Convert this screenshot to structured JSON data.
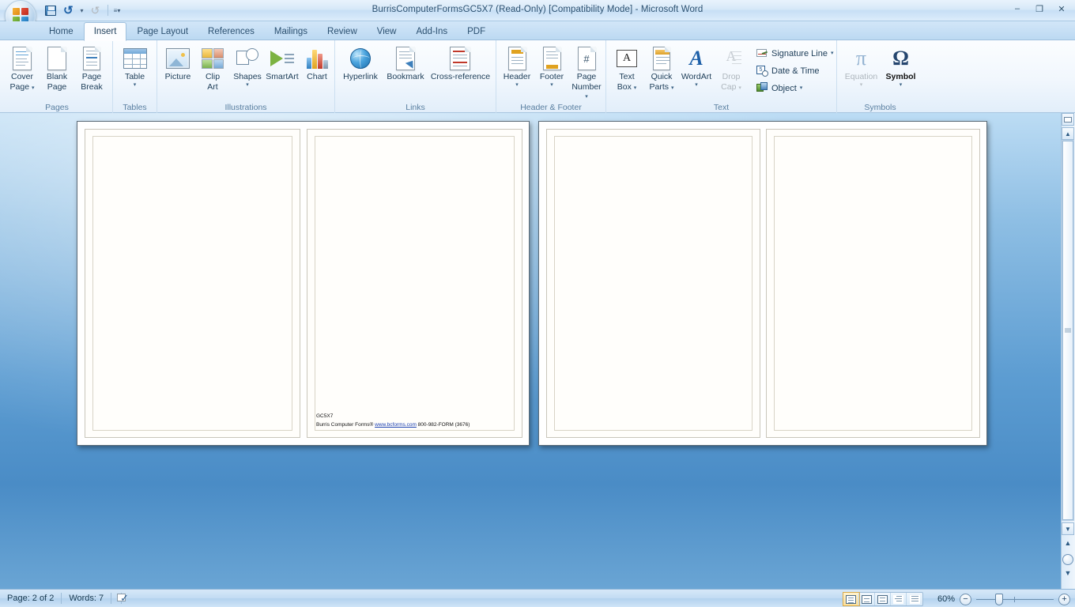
{
  "window": {
    "title": "BurrisComputerFormsGC5X7 (Read-Only) [Compatibility Mode] - Microsoft Word",
    "minimize": "–",
    "restore": "❐",
    "close": "✕",
    "help": "?"
  },
  "office_button": {
    "name": "Office Button"
  },
  "quick_access": {
    "save": "Save",
    "undo": "Undo",
    "redo": "Redo",
    "customize": "Customize Quick Access Toolbar"
  },
  "tabs": [
    {
      "label": "Home",
      "active": false
    },
    {
      "label": "Insert",
      "active": true
    },
    {
      "label": "Page Layout",
      "active": false
    },
    {
      "label": "References",
      "active": false
    },
    {
      "label": "Mailings",
      "active": false
    },
    {
      "label": "Review",
      "active": false
    },
    {
      "label": "View",
      "active": false
    },
    {
      "label": "Add-Ins",
      "active": false
    },
    {
      "label": "PDF",
      "active": false
    }
  ],
  "ribbon": {
    "groups": [
      {
        "name": "Pages",
        "label": "Pages",
        "buttons": [
          {
            "label_line1": "Cover",
            "label_line2": "Page",
            "dropdown": true,
            "disabled": false,
            "icon": "cover-page-icon"
          },
          {
            "label_line1": "Blank",
            "label_line2": "Page",
            "dropdown": false,
            "disabled": false,
            "icon": "blank-page-icon"
          },
          {
            "label_line1": "Page",
            "label_line2": "Break",
            "dropdown": false,
            "disabled": false,
            "icon": "page-break-icon"
          }
        ]
      },
      {
        "name": "Tables",
        "label": "Tables",
        "buttons": [
          {
            "label_line1": "Table",
            "label_line2": "",
            "dropdown": true,
            "disabled": false,
            "icon": "table-icon"
          }
        ]
      },
      {
        "name": "Illustrations",
        "label": "Illustrations",
        "buttons": [
          {
            "label_line1": "Picture",
            "label_line2": "",
            "dropdown": false,
            "disabled": false,
            "icon": "picture-icon"
          },
          {
            "label_line1": "Clip",
            "label_line2": "Art",
            "dropdown": false,
            "disabled": false,
            "icon": "clip-art-icon"
          },
          {
            "label_line1": "Shapes",
            "label_line2": "",
            "dropdown": true,
            "disabled": false,
            "icon": "shapes-icon"
          },
          {
            "label_line1": "SmartArt",
            "label_line2": "",
            "dropdown": false,
            "disabled": false,
            "icon": "smartart-icon"
          },
          {
            "label_line1": "Chart",
            "label_line2": "",
            "dropdown": false,
            "disabled": false,
            "icon": "chart-icon"
          }
        ]
      },
      {
        "name": "Links",
        "label": "Links",
        "buttons": [
          {
            "label_line1": "Hyperlink",
            "label_line2": "",
            "dropdown": false,
            "disabled": false,
            "icon": "hyperlink-icon"
          },
          {
            "label_line1": "Bookmark",
            "label_line2": "",
            "dropdown": false,
            "disabled": false,
            "icon": "bookmark-icon"
          },
          {
            "label_line1": "Cross-reference",
            "label_line2": "",
            "dropdown": false,
            "disabled": false,
            "icon": "cross-reference-icon"
          }
        ]
      },
      {
        "name": "Header & Footer",
        "label": "Header & Footer",
        "buttons": [
          {
            "label_line1": "Header",
            "label_line2": "",
            "dropdown": true,
            "disabled": false,
            "icon": "header-icon"
          },
          {
            "label_line1": "Footer",
            "label_line2": "",
            "dropdown": true,
            "disabled": false,
            "icon": "footer-icon"
          },
          {
            "label_line1": "Page",
            "label_line2": "Number",
            "dropdown": true,
            "disabled": false,
            "icon": "page-number-icon"
          }
        ]
      },
      {
        "name": "Text",
        "label": "Text",
        "buttons": [
          {
            "label_line1": "Text",
            "label_line2": "Box",
            "dropdown": true,
            "disabled": false,
            "icon": "text-box-icon"
          },
          {
            "label_line1": "Quick",
            "label_line2": "Parts",
            "dropdown": true,
            "disabled": false,
            "icon": "quick-parts-icon"
          },
          {
            "label_line1": "WordArt",
            "label_line2": "",
            "dropdown": true,
            "disabled": false,
            "icon": "wordart-icon"
          },
          {
            "label_line1": "Drop",
            "label_line2": "Cap",
            "dropdown": true,
            "disabled": true,
            "icon": "drop-cap-icon"
          }
        ],
        "small_buttons": [
          {
            "label": "Signature Line",
            "dropdown": true,
            "icon": "signature-line-icon"
          },
          {
            "label": "Date & Time",
            "dropdown": false,
            "icon": "date-time-icon"
          },
          {
            "label": "Object",
            "dropdown": true,
            "icon": "object-icon"
          }
        ]
      },
      {
        "name": "Symbols",
        "label": "Symbols",
        "buttons": [
          {
            "label_line1": "Equation",
            "label_line2": "",
            "dropdown": true,
            "disabled": true,
            "icon": "equation-icon"
          },
          {
            "label_line1": "Symbol",
            "label_line2": "",
            "dropdown": true,
            "disabled": false,
            "icon": "symbol-icon"
          }
        ]
      }
    ]
  },
  "document": {
    "spreads": [
      {
        "pages": [
          {
            "text_lines": []
          },
          {
            "text_lines": [
              "GC5X7"
            ],
            "footer_parts": {
              "before": "Burris Computer Forms® ",
              "link": "www.bcforms.com",
              "after": " 800-982-FORM (3676)"
            }
          }
        ]
      },
      {
        "pages": [
          {
            "text_lines": []
          },
          {
            "text_lines": []
          }
        ]
      }
    ]
  },
  "scrollbar": {
    "ruler_toggle": "View Ruler",
    "up": "▲",
    "down": "▼",
    "previous_page": "▲▲",
    "browse_object": "Select Browse Object",
    "next_page": "▼▼"
  },
  "status_bar": {
    "page": "Page: 2 of 2",
    "words": "Words: 7",
    "proofing": "Proofing errors check",
    "views": [
      {
        "name": "print-layout",
        "active": true
      },
      {
        "name": "full-screen-reading",
        "active": false
      },
      {
        "name": "web-layout",
        "active": false
      },
      {
        "name": "outline",
        "active": false
      },
      {
        "name": "draft",
        "active": false
      }
    ],
    "zoom_level": "60%",
    "zoom_out": "−",
    "zoom_in": "+"
  },
  "colors": {
    "accent": "#1c5fa8",
    "ribbon_bg": "#f1f7fd",
    "doc_bg": "#5d9dd2",
    "title_text": "#2b5070"
  }
}
